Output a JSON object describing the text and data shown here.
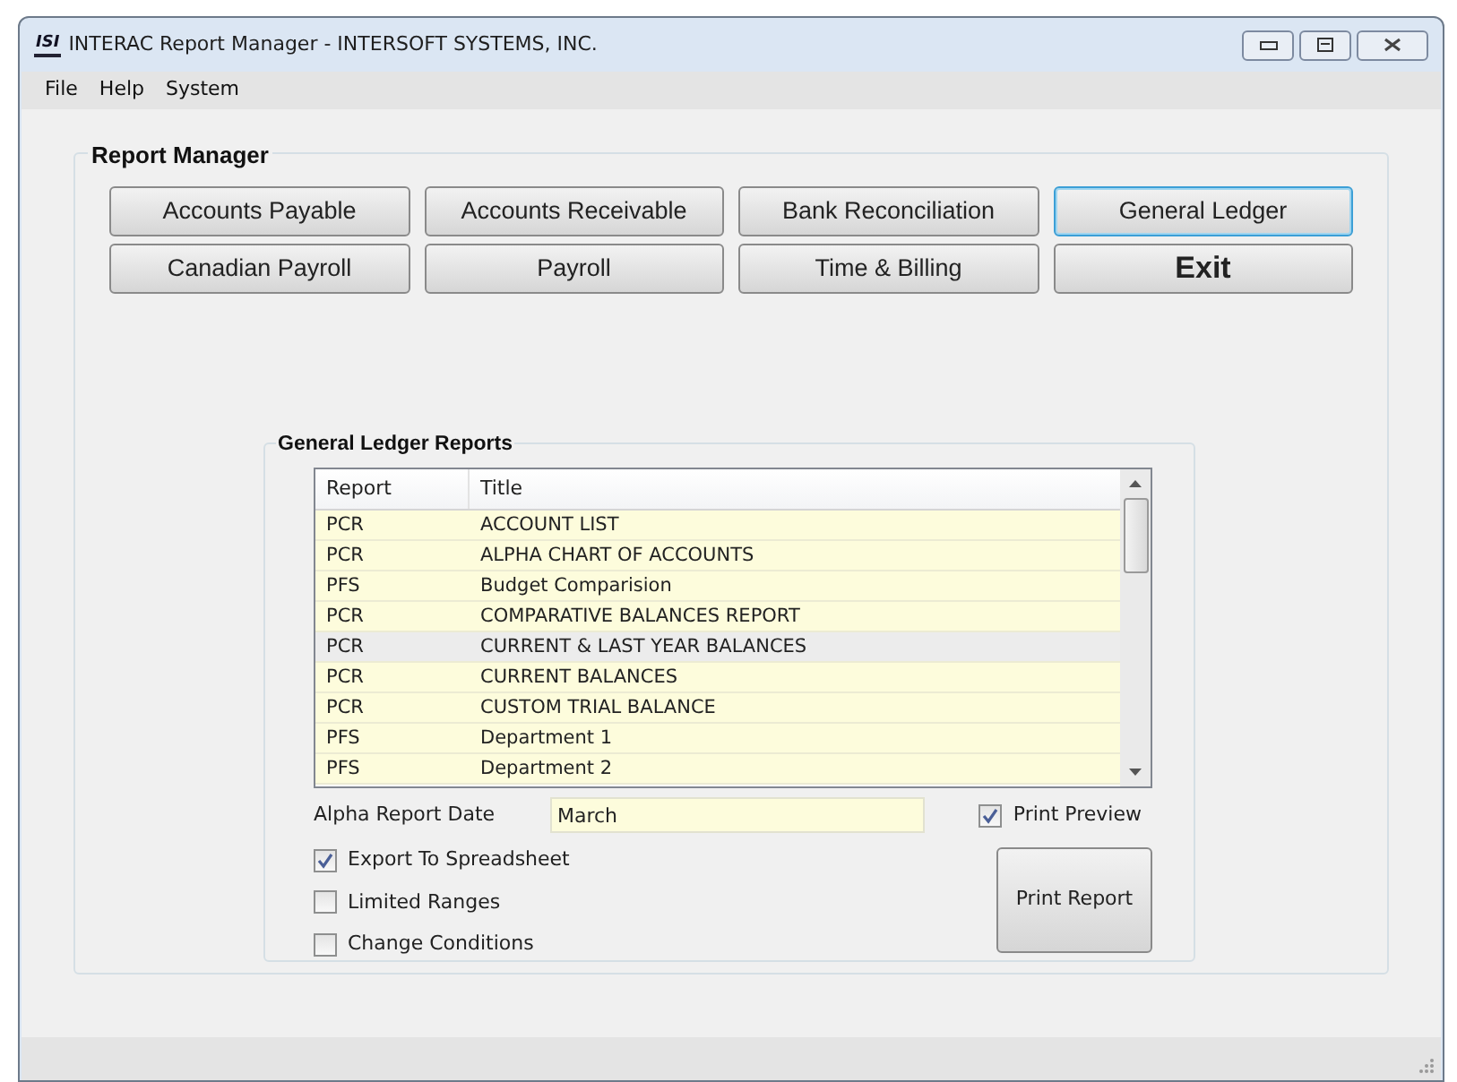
{
  "window": {
    "title": "INTERAC Report Manager - INTERSOFT SYSTEMS, INC.",
    "logo": "ISI"
  },
  "menu": [
    "File",
    "Help",
    "System"
  ],
  "report_manager": {
    "title": "Report Manager",
    "buttons": [
      {
        "label": "Accounts Payable",
        "selected": false,
        "bold": false
      },
      {
        "label": "Accounts Receivable",
        "selected": false,
        "bold": false
      },
      {
        "label": "Bank Reconciliation",
        "selected": false,
        "bold": false
      },
      {
        "label": "General Ledger",
        "selected": true,
        "bold": false
      },
      {
        "label": "Canadian Payroll",
        "selected": false,
        "bold": false
      },
      {
        "label": "Payroll",
        "selected": false,
        "bold": false
      },
      {
        "label": "Time & Billing",
        "selected": false,
        "bold": false
      },
      {
        "label": "Exit",
        "selected": false,
        "bold": true
      }
    ]
  },
  "reports": {
    "title": "General Ledger Reports",
    "table": {
      "columns": [
        "Report",
        "Title"
      ],
      "rows": [
        {
          "report": "PCR",
          "title": "ACCOUNT LIST",
          "selected": false
        },
        {
          "report": "PCR",
          "title": "ALPHA CHART OF ACCOUNTS",
          "selected": false
        },
        {
          "report": "PFS",
          "title": "Budget Comparision",
          "selected": false
        },
        {
          "report": "PCR",
          "title": "COMPARATIVE BALANCES REPORT",
          "selected": false
        },
        {
          "report": "PCR",
          "title": "CURRENT & LAST YEAR BALANCES",
          "selected": true
        },
        {
          "report": "PCR",
          "title": "CURRENT BALANCES",
          "selected": false
        },
        {
          "report": "PCR",
          "title": "CUSTOM TRIAL BALANCE",
          "selected": false
        },
        {
          "report": "PFS",
          "title": "Department 1",
          "selected": false
        },
        {
          "report": "PFS",
          "title": "Department 2",
          "selected": false
        }
      ]
    },
    "date_label": "Alpha Report Date",
    "date_value": "March",
    "print_preview": {
      "label": "Print Preview",
      "checked": true
    },
    "options": [
      {
        "label": "Export To Spreadsheet",
        "checked": true
      },
      {
        "label": "Limited Ranges",
        "checked": false
      },
      {
        "label": "Change Conditions",
        "checked": false
      }
    ],
    "print_button": "Print Report"
  }
}
